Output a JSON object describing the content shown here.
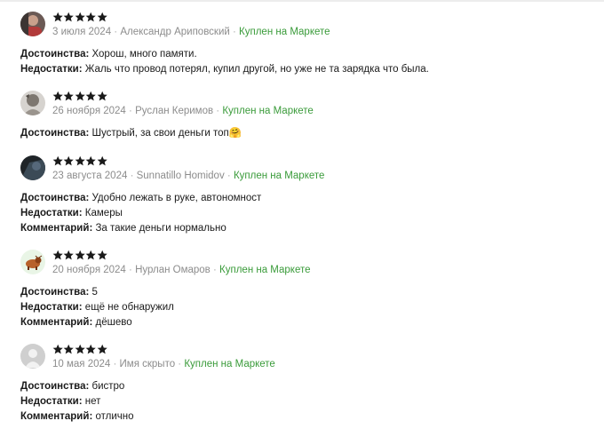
{
  "colors": {
    "star": "#1a1a1a",
    "meta_text": "#8c8c8c",
    "verified": "#3a9b3a",
    "body_text": "#1a1a1a"
  },
  "reviews": [
    {
      "rating": 5,
      "avatar": "user-photo-1",
      "date": "3 июля 2024",
      "author": "Александр Ариповский",
      "badge": "Куплен на Маркете",
      "lines": [
        {
          "label": "Достоинства:",
          "text": "Хорош, много памяти."
        },
        {
          "label": "Недостатки:",
          "text": "Жаль что провод потерял, купил другой, но уже не та зарядка что была."
        }
      ]
    },
    {
      "rating": 5,
      "avatar": "user-photo-2",
      "date": "26 ноября 2024",
      "author": "Руслан Керимов",
      "badge": "Куплен на Маркете",
      "lines": [
        {
          "label": "Достоинства:",
          "text": "Шустрый, за свои деньги топ🤗"
        }
      ]
    },
    {
      "rating": 5,
      "avatar": "user-photo-3",
      "date": "23 августа 2024",
      "author": "Sunnatillo Homidov",
      "badge": "Куплен на Маркете",
      "lines": [
        {
          "label": "Достоинства:",
          "text": "Удобно лежать в руке, автономност"
        },
        {
          "label": "Недостатки:",
          "text": "Камеры"
        },
        {
          "label": "Комментарий:",
          "text": "За такие деньги нормально"
        }
      ]
    },
    {
      "rating": 5,
      "avatar": "user-photo-4",
      "date": "20 ноября 2024",
      "author": "Нурлан Омаров",
      "badge": "Куплен на Маркете",
      "lines": [
        {
          "label": "Достоинства:",
          "text": "5"
        },
        {
          "label": "Недостатки:",
          "text": "ещё не обнаружил"
        },
        {
          "label": "Комментарий:",
          "text": "дёшево"
        }
      ]
    },
    {
      "rating": 5,
      "avatar": "default-avatar",
      "date": "10 мая 2024",
      "author": "Имя скрыто",
      "badge": "Куплен на Маркете",
      "lines": [
        {
          "label": "Достоинства:",
          "text": "бистро"
        },
        {
          "label": "Недостатки:",
          "text": "нет"
        },
        {
          "label": "Комментарий:",
          "text": "отлично"
        }
      ]
    }
  ]
}
